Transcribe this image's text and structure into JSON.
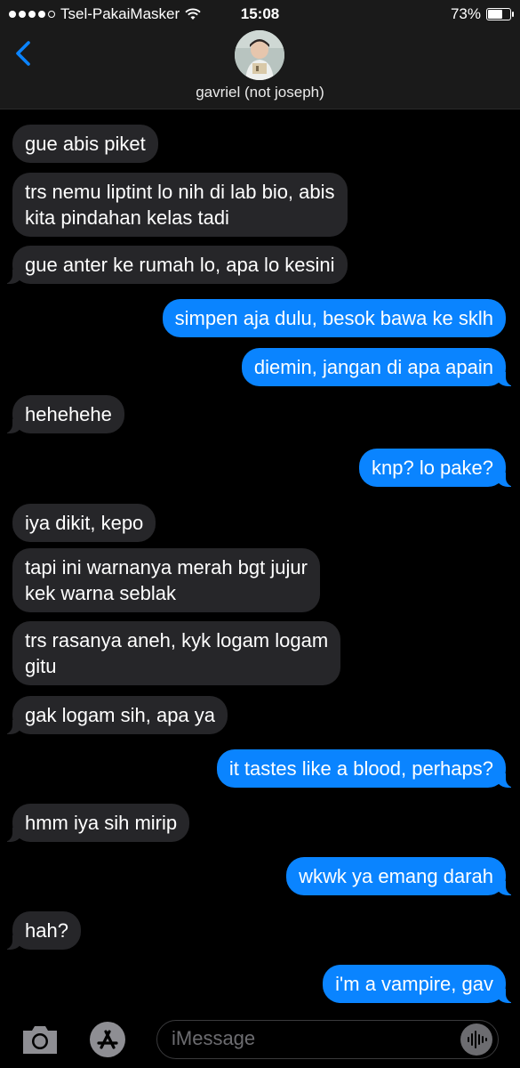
{
  "status_bar": {
    "carrier": "Tsel-PakaiMasker",
    "time": "15:08",
    "battery_percent": "73%",
    "battery_level": 0.73,
    "signal_bars_filled": 4,
    "signal_bars_total": 5
  },
  "header": {
    "contact_name": "gavriel (not joseph)"
  },
  "messages": [
    {
      "text": "gue abis piket",
      "from": "them"
    },
    {
      "text": "trs nemu liptint lo nih di lab bio, abis\nkita pindahan kelas tadi",
      "from": "them"
    },
    {
      "text": "gue anter ke rumah lo, apa lo kesini",
      "from": "them"
    },
    {
      "text": "simpen aja dulu, besok bawa ke sklh",
      "from": "me"
    },
    {
      "text": "diemin, jangan di apa apain",
      "from": "me"
    },
    {
      "text": "hehehehe",
      "from": "them"
    },
    {
      "text": "knp? lo pake?",
      "from": "me"
    },
    {
      "text": "iya dikit, kepo",
      "from": "them"
    },
    {
      "text": "tapi ini warnanya merah bgt jujur\nkek warna seblak",
      "from": "them"
    },
    {
      "text": "trs rasanya aneh, kyk logam logam\ngitu",
      "from": "them"
    },
    {
      "text": "gak logam sih, apa ya",
      "from": "them"
    },
    {
      "text": "it tastes like a blood, perhaps?",
      "from": "me"
    },
    {
      "text": "hmm iya sih mirip",
      "from": "them"
    },
    {
      "text": "wkwk ya emang darah",
      "from": "me"
    },
    {
      "text": "hah?",
      "from": "them"
    },
    {
      "text": "i'm a vampire, gav",
      "from": "me"
    }
  ],
  "input_bar": {
    "placeholder": "iMessage"
  },
  "colors": {
    "incoming_bubble": "#262629",
    "outgoing_bubble": "#0a84ff",
    "accent": "#0a84ff",
    "background": "#000000"
  },
  "icons": [
    "wifi-icon",
    "back-chevron-icon",
    "camera-icon",
    "app-store-icon",
    "audio-waveform-icon"
  ]
}
